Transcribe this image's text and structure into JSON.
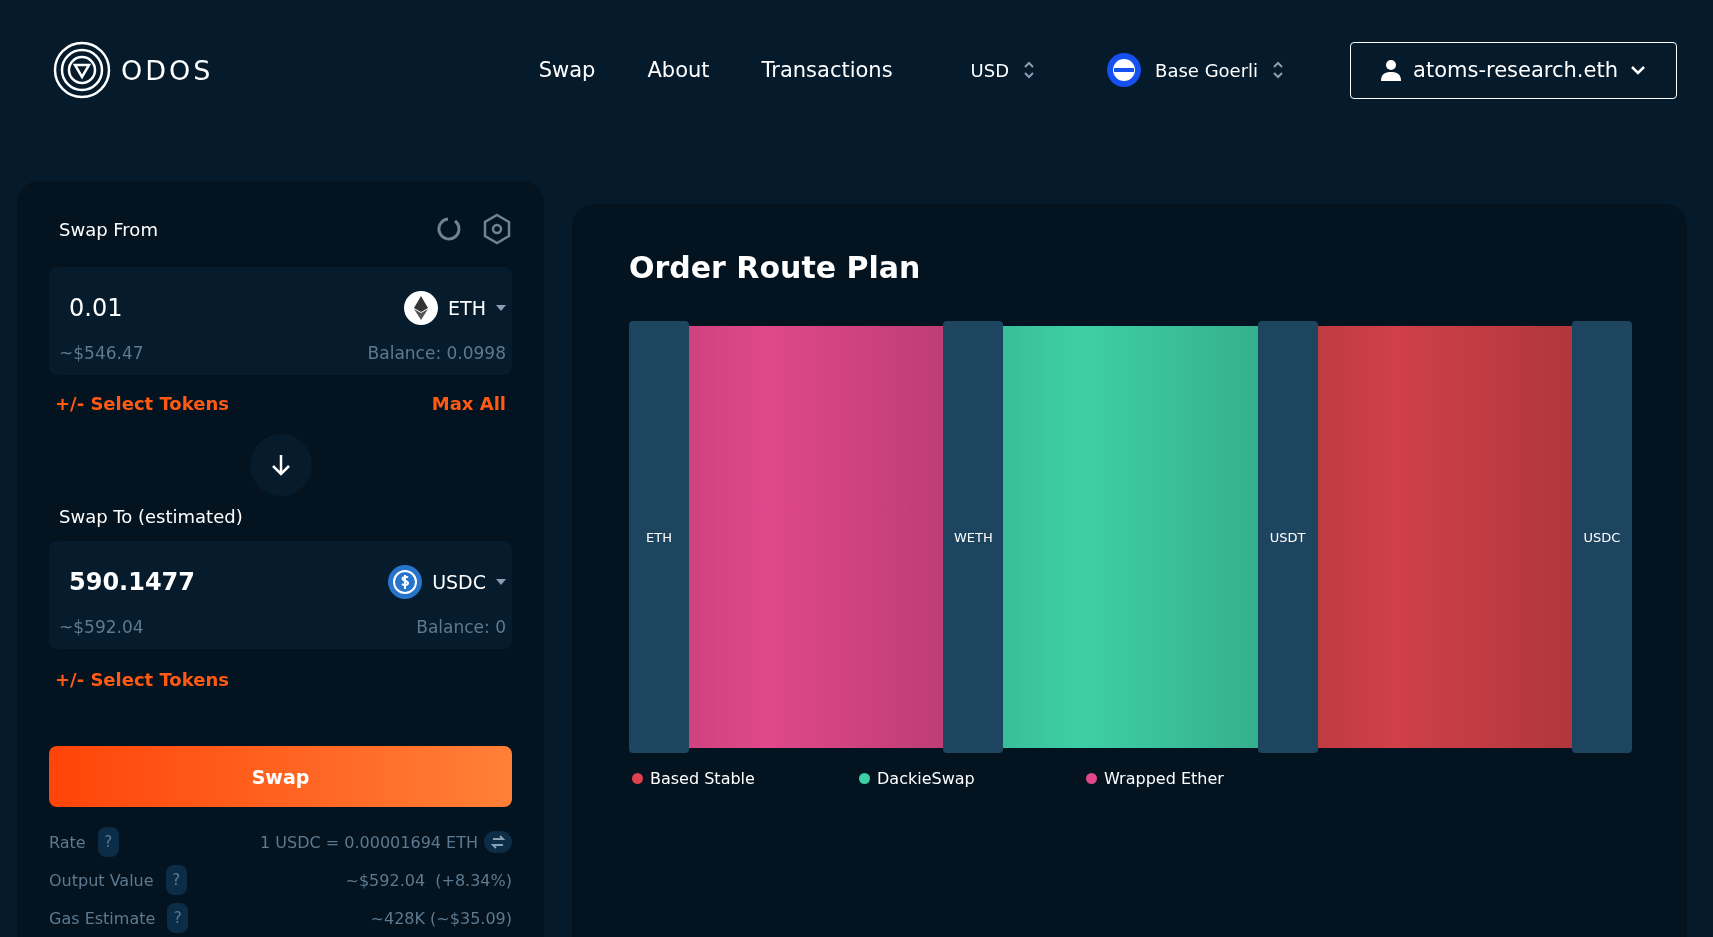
{
  "header": {
    "logo": "ODOS",
    "nav": [
      {
        "label": "Swap"
      },
      {
        "label": "About"
      },
      {
        "label": "Transactions"
      }
    ],
    "currency": "USD",
    "network": "Base Goerli",
    "account": "atoms-research.eth"
  },
  "swap": {
    "from_title": "Swap From",
    "from": {
      "amount": "0.01",
      "token": "ETH",
      "kind": "eth",
      "usd": "~$546.47",
      "balance": "Balance: 0.0998"
    },
    "from_select": "+/- Select Tokens",
    "max_all": "Max All",
    "to_title": "Swap To (estimated)",
    "to": {
      "amount": "590.1477",
      "token": "USDC",
      "kind": "usdc",
      "usd": "~$592.04",
      "balance": "Balance: 0"
    },
    "to_select": "+/- Select Tokens",
    "button": "Swap",
    "details": [
      {
        "label": "Rate",
        "help": "?",
        "value": "1 USDC = 0.00001694 ETH",
        "kind": "rate"
      },
      {
        "label": "Output Value",
        "help": "?",
        "value": "~$592.04  (+8.34%)",
        "kind": "plain"
      },
      {
        "label": "Gas Estimate",
        "help": "?",
        "value": "~428K (~$35.09)",
        "kind": "plain"
      }
    ]
  },
  "route": {
    "title": "Order Route Plan",
    "nodes": [
      "ETH",
      "WETH",
      "USDT",
      "USDC"
    ],
    "flows": [
      {
        "color": "#e0488a"
      },
      {
        "color": "#3ecfa6"
      },
      {
        "color": "#d04048"
      }
    ],
    "legend": [
      {
        "label": "Based Stable",
        "color": "#e04050"
      },
      {
        "label": "DackieSwap",
        "color": "#3ecfa6"
      },
      {
        "label": "Wrapped Ether",
        "color": "#e0488a"
      }
    ]
  }
}
